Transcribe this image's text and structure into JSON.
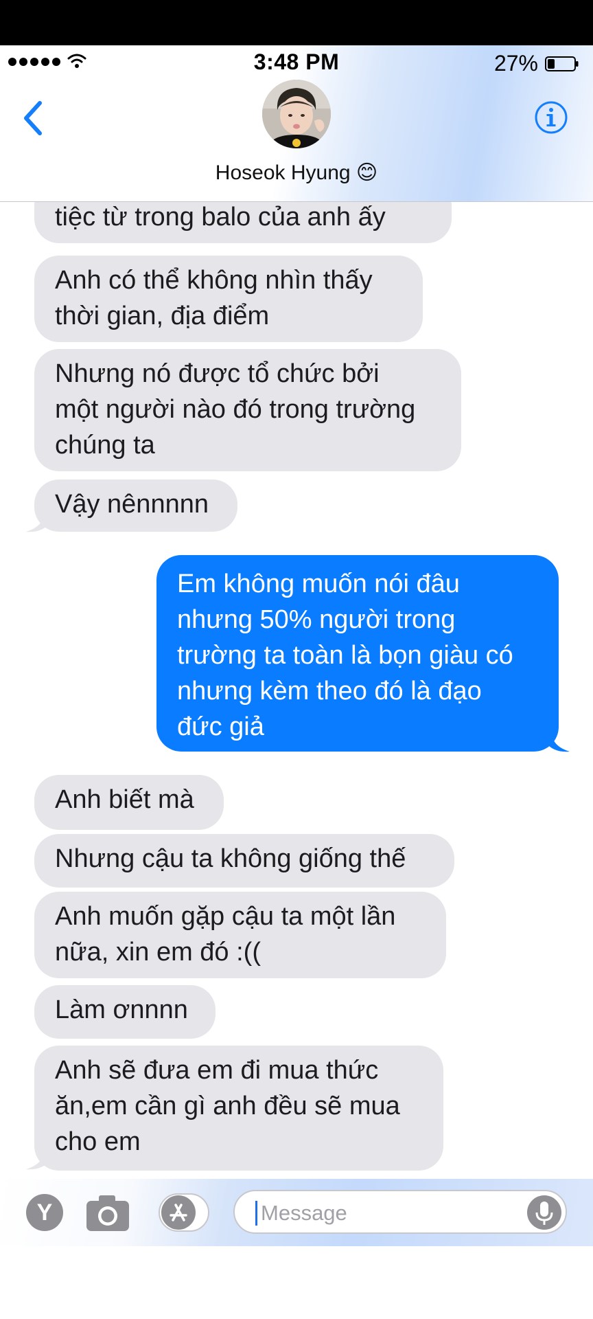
{
  "status_bar": {
    "time": "3:48 PM",
    "battery_percent": "27%",
    "battery_level": 0.27,
    "signal_icon": "cellular-dots-icon",
    "wifi_icon": "wifi-icon"
  },
  "header": {
    "contact_name": "Hoseok Hyung 😊",
    "back_icon": "chevron-left-icon",
    "info_icon": "info-circle-icon"
  },
  "messages": [
    {
      "direction": "received",
      "lines": [
        "tiệc từ trong balo của anh ấy"
      ]
    },
    {
      "direction": "received",
      "lines": [
        "Anh có thể không nhìn thấy",
        "thời gian, địa điểm"
      ]
    },
    {
      "direction": "received",
      "lines": [
        "Nhưng nó được tổ chức bởi",
        "một người nào đó trong trường",
        "chúng ta"
      ]
    },
    {
      "direction": "received",
      "lines": [
        "Vậy nênnnnn"
      ]
    },
    {
      "direction": "sent",
      "lines": [
        "Em không muốn nói đâu",
        "nhưng 50% người trong",
        "trường ta toàn là bọn giàu có",
        "nhưng kèm theo đó là đạo",
        "đức giả"
      ]
    },
    {
      "direction": "received",
      "lines": [
        "Anh biết mà"
      ]
    },
    {
      "direction": "received",
      "lines": [
        "Nhưng cậu ta không giống thế"
      ]
    },
    {
      "direction": "received",
      "lines": [
        "Anh muốn gặp cậu ta một lần",
        "nữa, xin em đó :(("
      ]
    },
    {
      "direction": "received",
      "lines": [
        "Làm ơnnnn"
      ]
    },
    {
      "direction": "received",
      "lines": [
        "Anh sẽ đưa em đi mua thức",
        "ăn,em cần gì anh đều sẽ mua",
        "cho em"
      ]
    }
  ],
  "composer": {
    "placeholder": "Message",
    "left_app_label": "Y",
    "icons": [
      "yahoo-y-icon",
      "camera-icon",
      "app-store-icon",
      "microphone-icon"
    ]
  },
  "colors": {
    "received_bubble": "#e5e5ea",
    "sent_bubble": "#0a7cff",
    "accent": "#147efb"
  }
}
